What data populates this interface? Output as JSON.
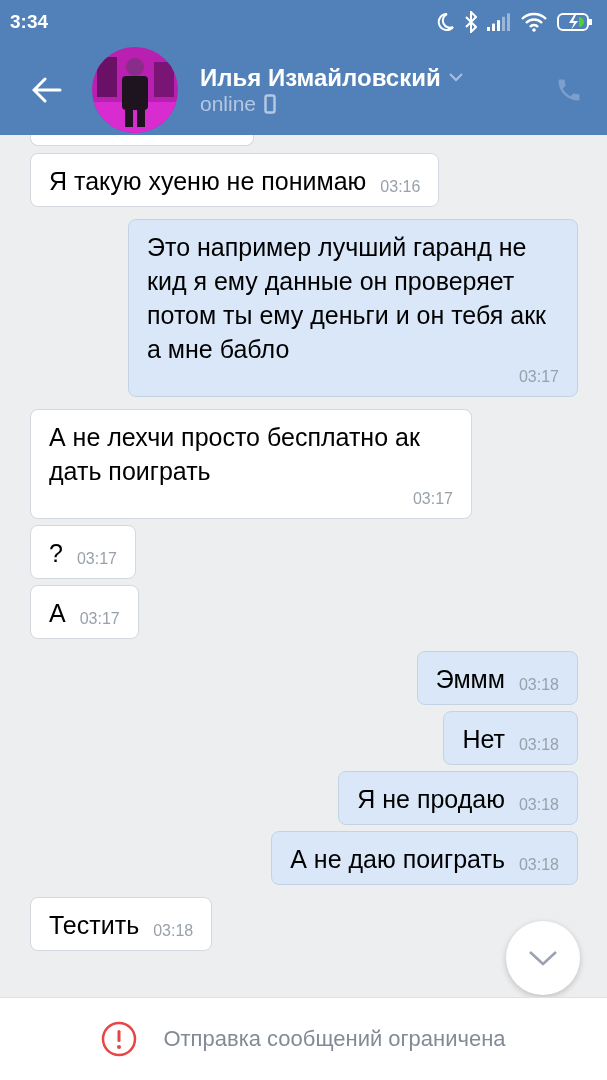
{
  "status_bar": {
    "time": "3:34"
  },
  "header": {
    "name": "Илья Измайловский",
    "status": "online"
  },
  "messages": [
    {
      "kind": "incoming",
      "text": "Я такую хуеню не понимаю",
      "time": "03:16"
    },
    {
      "kind": "outgoing",
      "text": "Это например лучший гаранд не кид я ему данные он проверяет потом ты ему деньги и он тебя акк а мне бабло",
      "time": "03:17"
    },
    {
      "kind": "incoming",
      "text": "А не лехчи просто бесплатно ак дать поиграть",
      "time": "03:17"
    },
    {
      "kind": "incoming",
      "text": "?",
      "time": "03:17"
    },
    {
      "kind": "incoming",
      "text": "А",
      "time": "03:17"
    },
    {
      "kind": "outgoing",
      "text": "Эммм",
      "time": "03:18"
    },
    {
      "kind": "outgoing",
      "text": "Нет",
      "time": "03:18"
    },
    {
      "kind": "outgoing",
      "text": "Я не продаю",
      "time": "03:18"
    },
    {
      "kind": "outgoing",
      "text": "А не даю поиграть",
      "time": "03:18"
    },
    {
      "kind": "incoming",
      "text": "Тестить",
      "time": "03:18"
    }
  ],
  "footer": {
    "notice": "Отправка сообщений ограничена"
  }
}
